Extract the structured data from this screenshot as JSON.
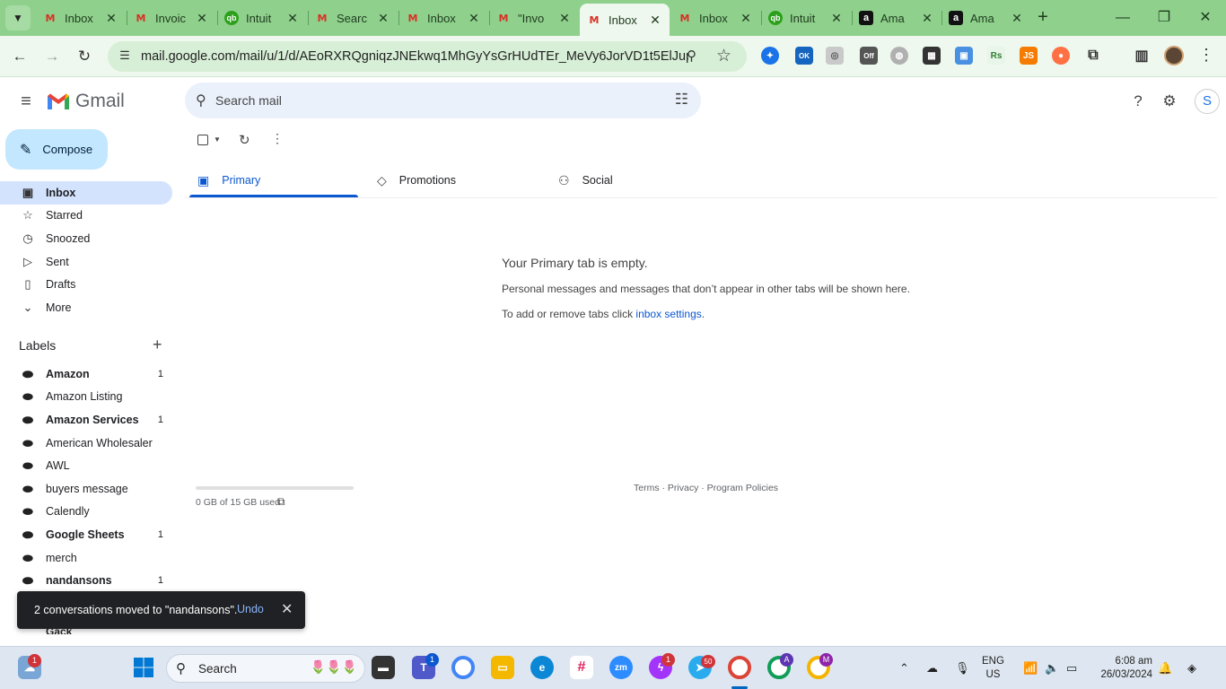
{
  "browser": {
    "tabs": [
      {
        "title": "Inbox",
        "icon": "gmail"
      },
      {
        "title": "Invoic",
        "icon": "gmail"
      },
      {
        "title": "Intuit",
        "icon": "intuit"
      },
      {
        "title": "Searc",
        "icon": "gmail"
      },
      {
        "title": "Inbox",
        "icon": "gmail"
      },
      {
        "title": "\"Invo",
        "icon": "gmail"
      },
      {
        "title": "Inbox",
        "icon": "gmail",
        "active": true
      },
      {
        "title": "Inbox",
        "icon": "gmail"
      },
      {
        "title": "Intuit",
        "icon": "intuit"
      },
      {
        "title": "Ama",
        "icon": "amazon"
      },
      {
        "title": "Ama",
        "icon": "amazon"
      }
    ],
    "url": "mail.google.com/mail/u/1/d/AEoRXRQgniqzJNEkwq1MhGyYsGrHUdTEr_MeVy6JorVD1t5ElJup/#i...",
    "extension_badges": [
      "OK",
      "Off",
      "Rs",
      "JS"
    ]
  },
  "gmail": {
    "app_name": "Gmail",
    "search_placeholder": "Search mail",
    "account_initial": "S",
    "compose_label": "Compose",
    "nav": [
      {
        "label": "Inbox",
        "icon": "inbox-icon",
        "active": true
      },
      {
        "label": "Starred",
        "icon": "star-icon"
      },
      {
        "label": "Snoozed",
        "icon": "clock-icon"
      },
      {
        "label": "Sent",
        "icon": "send-icon"
      },
      {
        "label": "Drafts",
        "icon": "draft-icon"
      },
      {
        "label": "More",
        "icon": "chevron-down-icon"
      }
    ],
    "labels_header": "Labels",
    "labels": [
      {
        "label": "Amazon",
        "count": "1",
        "bold": true
      },
      {
        "label": "Amazon Listing",
        "count": ""
      },
      {
        "label": "Amazon Services",
        "count": "1",
        "bold": true
      },
      {
        "label": "American Wholesaler",
        "count": ""
      },
      {
        "label": "AWL",
        "count": ""
      },
      {
        "label": "buyers message",
        "count": ""
      },
      {
        "label": "Calendly",
        "count": ""
      },
      {
        "label": "Google Sheets",
        "count": "1",
        "bold": true
      },
      {
        "label": "merch",
        "count": ""
      },
      {
        "label": "nandansons",
        "count": "1",
        "bold": true
      }
    ],
    "partial_label": "Gack",
    "categories": [
      {
        "label": "Primary",
        "active": true
      },
      {
        "label": "Promotions"
      },
      {
        "label": "Social"
      }
    ],
    "empty_title": "Your Primary tab is empty.",
    "empty_desc": "Personal messages and messages that don’t appear in other tabs will be shown here.",
    "empty_line2_prefix": "To add or remove tabs click ",
    "empty_line2_link": "inbox settings",
    "empty_line2_suffix": ".",
    "storage": "0 GB of 15 GB used",
    "storage_fraction": 0,
    "footer": "Terms · Privacy · Program Policies",
    "snackbar": {
      "message": "2 conversations moved to \"nandansons\".",
      "action": "Undo"
    }
  },
  "taskbar": {
    "search_label": "Search",
    "language": [
      "ENG",
      "US"
    ],
    "time": "6:08 am",
    "date": "26/03/2024",
    "badges": {
      "weather": "1",
      "teams": "1",
      "messenger": "1",
      "telegram": "50",
      "chrome_a": "A",
      "chrome_m": "M"
    }
  },
  "colors": {
    "tabstrip": "#8fd18c",
    "toolbar": "#eef8ee",
    "compose": "#c2e7ff",
    "nav_active": "#d3e3fd",
    "accent": "#0b57d0"
  }
}
